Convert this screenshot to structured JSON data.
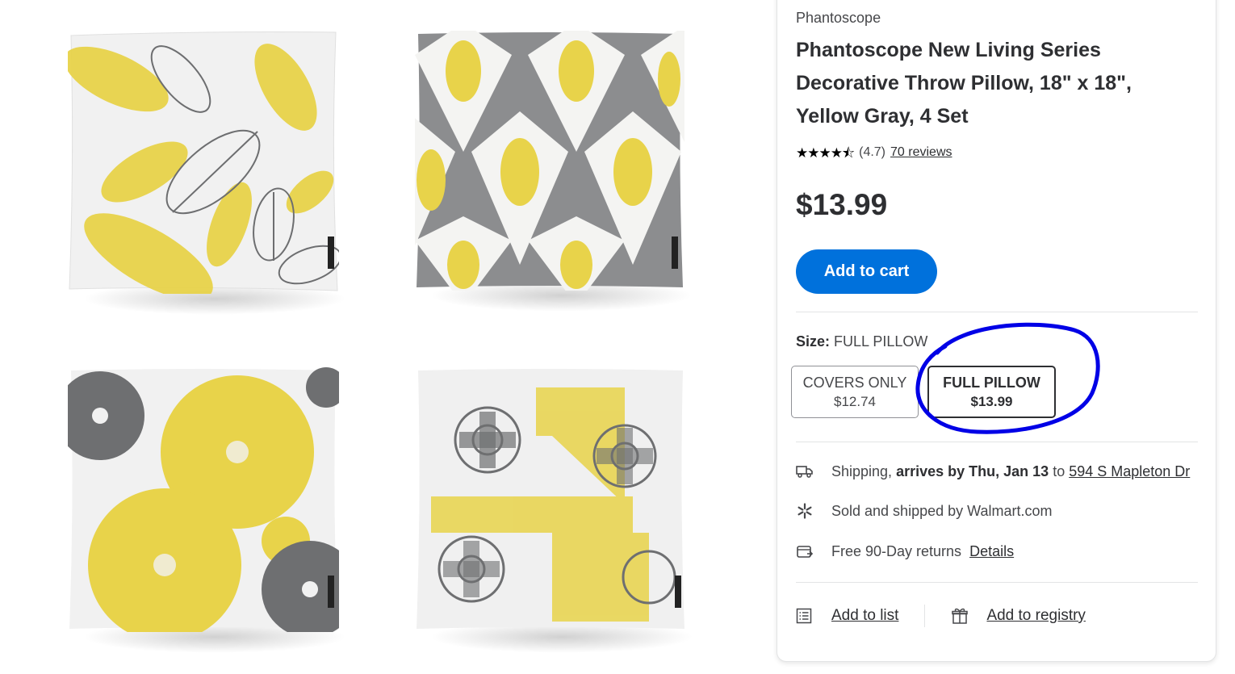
{
  "product": {
    "brand": "Phantoscope",
    "title": "Phantoscope New Living Series Decorative Throw Pillow, 18\" x 18\", Yellow Gray, 4 Set",
    "rating_value": "(4.7)",
    "rating_stars": 4.7,
    "reviews_link": "70 reviews",
    "price": "$13.99",
    "add_to_cart": "Add to cart"
  },
  "size": {
    "label": "Size:",
    "selected": "FULL PILLOW",
    "options": [
      {
        "name": "COVERS ONLY",
        "price": "$12.74",
        "selected": false
      },
      {
        "name": "FULL PILLOW",
        "price": "$13.99",
        "selected": true
      }
    ]
  },
  "fulfillment": {
    "shipping_label": "Shipping,",
    "shipping_arrives": "arrives by Thu, Jan 13",
    "shipping_to": "to",
    "shipping_address": "594 S Mapleton Dr",
    "sold_by": "Sold and shipped by Walmart.com",
    "returns_text": "Free 90-Day returns",
    "returns_link": "Details"
  },
  "actions": {
    "add_to_list": "Add to list",
    "add_to_registry": "Add to registry"
  },
  "colors": {
    "accent_blue": "#0071dc",
    "annotation_blue": "#0000e6",
    "pillow_yellow": "#e8d34a",
    "pillow_gray": "#8c8d8f"
  },
  "icons": [
    "truck-icon",
    "walmart-spark-icon",
    "returns-icon",
    "list-icon",
    "gift-icon"
  ]
}
